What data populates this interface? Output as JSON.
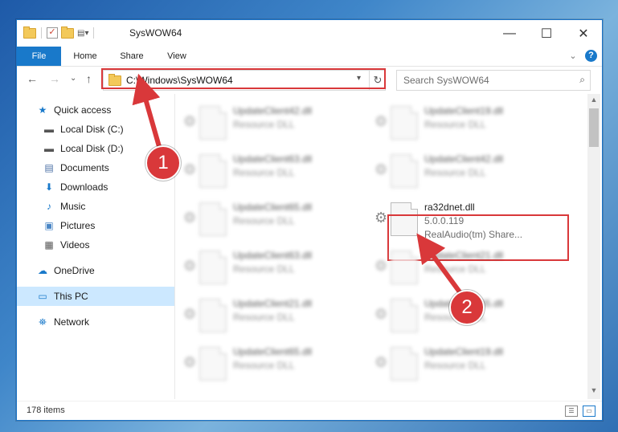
{
  "window": {
    "title": "SysWOW64",
    "controls": {
      "minimize": "—",
      "maximize": "☐",
      "close": "✕"
    }
  },
  "ribbon": {
    "tabs": [
      "File",
      "Home",
      "Share",
      "View"
    ],
    "help": "?",
    "expand": "⌄"
  },
  "nav": {
    "back": "←",
    "forward": "→",
    "recent": "⌄",
    "up": "↑",
    "address": "C:\\Windows\\SysWOW64",
    "refresh": "↻",
    "search_placeholder": "Search SysWOW64",
    "search_icon": "⌕"
  },
  "sidebar": {
    "items": [
      {
        "label": "Quick access",
        "icon": "star-icon",
        "glyph": "★",
        "color": "#1979ca",
        "pinned": false
      },
      {
        "label": "Local Disk (C:)",
        "icon": "drive-icon",
        "glyph": "▬",
        "color": "#555",
        "pinned": true
      },
      {
        "label": "Local Disk (D:)",
        "icon": "drive-icon",
        "glyph": "▬",
        "color": "#555",
        "pinned": true
      },
      {
        "label": "Documents",
        "icon": "document-icon",
        "glyph": "▤",
        "color": "#4a6fa5",
        "pinned": true
      },
      {
        "label": "Downloads",
        "icon": "download-icon",
        "glyph": "⬇",
        "color": "#1979ca",
        "pinned": true
      },
      {
        "label": "Music",
        "icon": "music-icon",
        "glyph": "♪",
        "color": "#1979ca",
        "pinned": true
      },
      {
        "label": "Pictures",
        "icon": "pictures-icon",
        "glyph": "▣",
        "color": "#4a86c5",
        "pinned": true
      },
      {
        "label": "Videos",
        "icon": "videos-icon",
        "glyph": "▦",
        "color": "#555",
        "pinned": true
      },
      {
        "label": "OneDrive",
        "icon": "cloud-icon",
        "glyph": "☁",
        "color": "#1979ca",
        "pinned": false
      },
      {
        "label": "This PC",
        "icon": "computer-icon",
        "glyph": "▭",
        "color": "#1979ca",
        "pinned": false
      },
      {
        "label": "Network",
        "icon": "network-icon",
        "glyph": "⛯",
        "color": "#1979ca",
        "pinned": false
      }
    ]
  },
  "files": [
    {
      "name": "UpdateClient42.dll",
      "line2": "Resource DLL",
      "line3": ""
    },
    {
      "name": "UpdateClient19.dll",
      "line2": "Resource DLL",
      "line3": ""
    },
    {
      "name": "UpdateClient63.dll",
      "line2": "Resource DLL",
      "line3": ""
    },
    {
      "name": "UpdateClient42.dll",
      "line2": "Resource DLL",
      "line3": ""
    },
    {
      "name": "UpdateClient65.dll",
      "line2": "Resource DLL",
      "line3": ""
    },
    {
      "name": "ra32dnet.dll",
      "line2": "5.0.0.119",
      "line3": "RealAudio(tm) Share..."
    },
    {
      "name": "UpdateClient63.dll",
      "line2": "Resource DLL",
      "line3": ""
    },
    {
      "name": "UpdateClient21.dll",
      "line2": "Resource DLL",
      "line3": ""
    },
    {
      "name": "UpdateClient21.dll",
      "line2": "Resource DLL",
      "line3": ""
    },
    {
      "name": "UpdateClient65.dll",
      "line2": "Resource DLL",
      "line3": ""
    },
    {
      "name": "UpdateClient65.dll",
      "line2": "Resource DLL",
      "line3": ""
    },
    {
      "name": "UpdateClient19.dll",
      "line2": "Resource DLL",
      "line3": ""
    }
  ],
  "status": {
    "count": "178 items"
  },
  "markers": {
    "one": "1",
    "two": "2"
  },
  "colors": {
    "accent": "#1979ca",
    "highlight": "#d9383a",
    "selected": "#cce8ff"
  }
}
